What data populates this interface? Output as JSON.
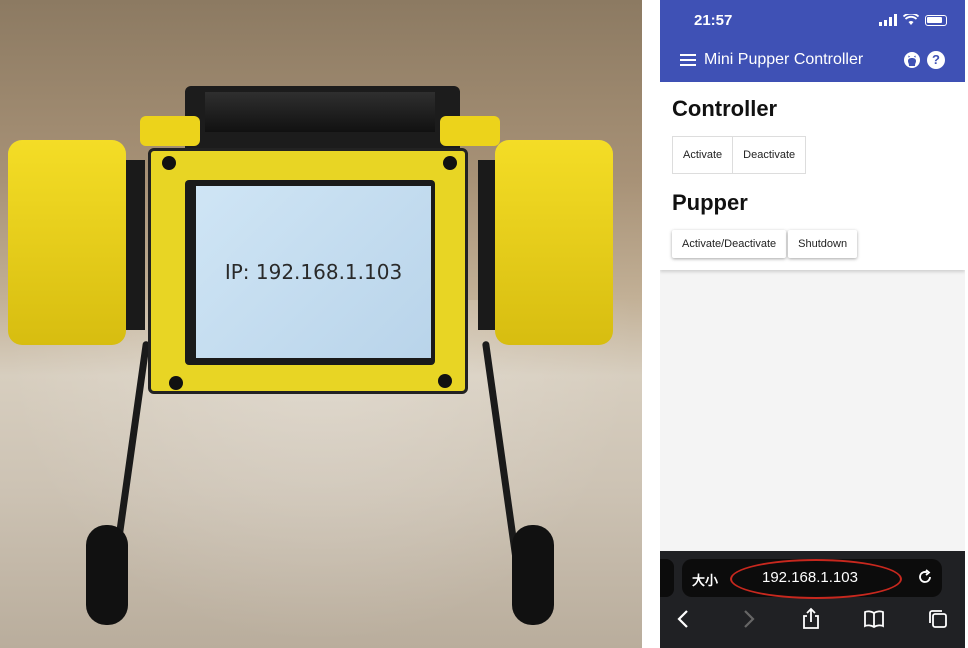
{
  "photo": {
    "lcd_text": "IP: 192.168.1.103"
  },
  "phone": {
    "status_time": "21:57",
    "app_title": "Mini Pupper Controller",
    "sections": [
      {
        "title": "Controller",
        "buttons": [
          "Activate",
          "Deactivate"
        ]
      },
      {
        "title": "Pupper",
        "buttons": [
          "Activate/Deactivate",
          "Shutdown"
        ]
      }
    ],
    "browser": {
      "size_label": "大小",
      "url": "192.168.1.103"
    },
    "colors": {
      "app_bar": "#3f51b5",
      "highlight_circle": "#c8281e"
    },
    "icons": [
      "menu-icon",
      "github-icon",
      "help-icon",
      "reload-icon",
      "back-icon",
      "forward-icon",
      "share-icon",
      "bookmarks-icon",
      "tabs-icon"
    ]
  }
}
